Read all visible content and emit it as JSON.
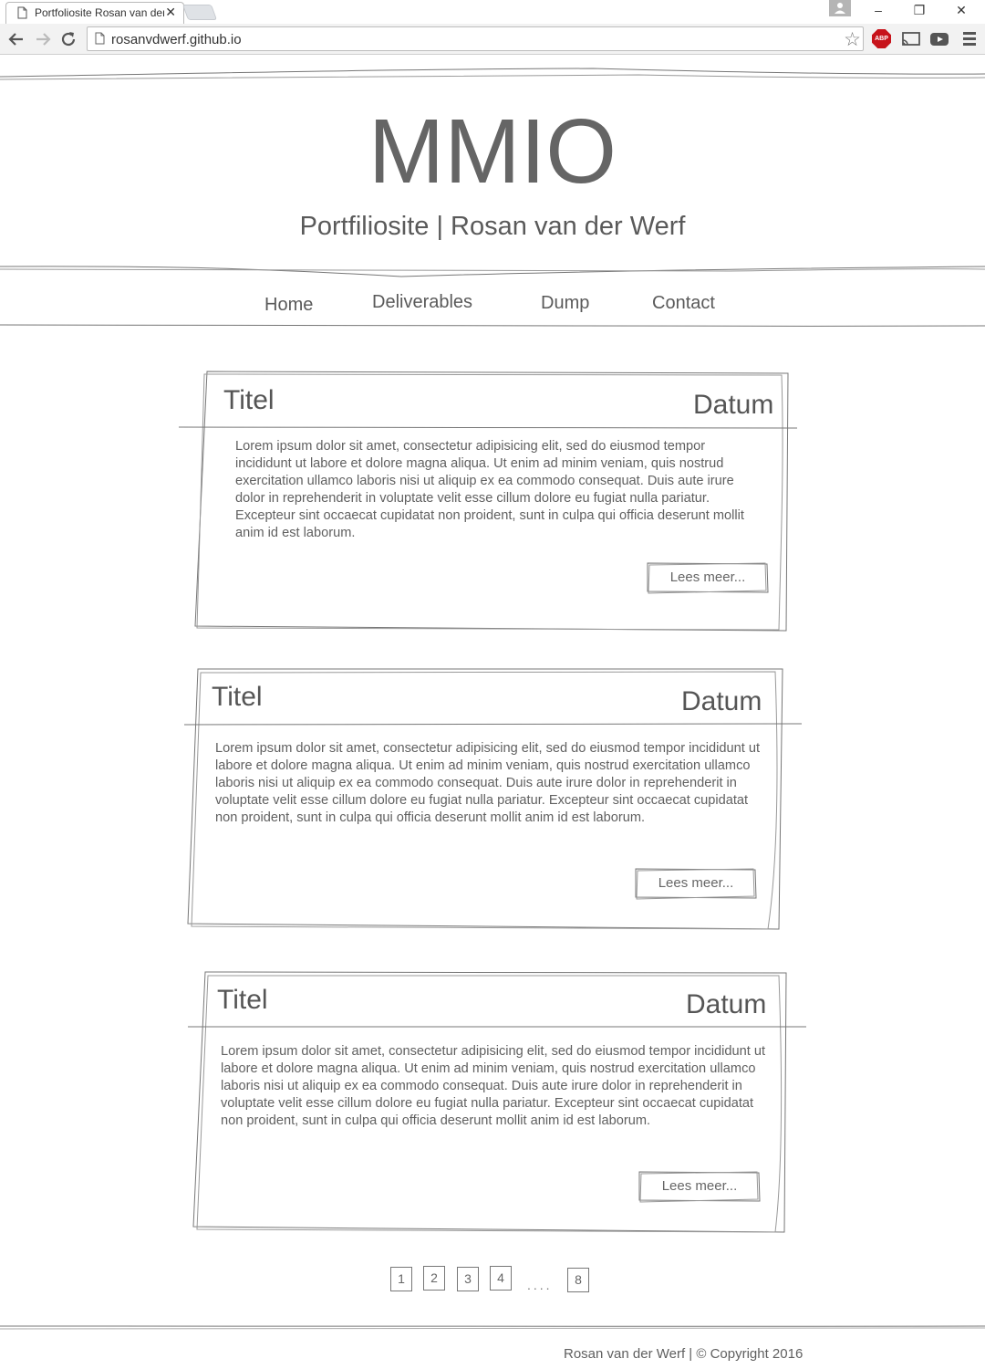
{
  "browser": {
    "tab_title": "Portfoliosite Rosan van der Werf",
    "url": "rosanvdwerf.github.io",
    "tab_close": "✕",
    "window_controls": {
      "minimize": "–",
      "restore": "❐",
      "close": "✕"
    },
    "extensions": [
      "abp-icon",
      "cast-icon",
      "youtube-icon"
    ],
    "abp_label": "ABP"
  },
  "header": {
    "title": "MMIO",
    "subtitle": "Portfiliosite | Rosan van der Werf"
  },
  "nav": {
    "items": [
      {
        "label": "Home"
      },
      {
        "label": "Deliverables"
      },
      {
        "label": "Dump"
      },
      {
        "label": "Contact"
      }
    ]
  },
  "posts": [
    {
      "title": "Titel",
      "date": "Datum",
      "body": "Lorem ipsum dolor sit amet, consectetur adipisicing elit, sed do eiusmod tempor incididunt ut labore et dolore magna aliqua. Ut enim ad minim veniam, quis nostrud exercitation ullamco laboris nisi ut aliquip ex ea commodo consequat. Duis aute irure dolor in reprehenderit in voluptate velit esse cillum dolore eu fugiat nulla pariatur. Excepteur sint occaecat cupidatat non proident, sunt in culpa qui officia deserunt mollit anim id est laborum.",
      "button": "Lees meer..."
    },
    {
      "title": "Titel",
      "date": "Datum",
      "body": "Lorem ipsum dolor sit amet, consectetur adipisicing elit, sed do eiusmod tempor incididunt ut labore et dolore magna aliqua. Ut enim ad minim veniam, quis nostrud exercitation ullamco laboris nisi ut aliquip ex ea commodo consequat. Duis aute irure dolor in reprehenderit in voluptate velit esse cillum dolore eu fugiat nulla pariatur. Excepteur sint occaecat cupidatat non proident, sunt in culpa qui officia deserunt mollit anim id est laborum.",
      "button": "Lees meer..."
    },
    {
      "title": "Titel",
      "date": "Datum",
      "body": "Lorem ipsum dolor sit amet, consectetur adipisicing elit, sed do eiusmod tempor incididunt ut labore et dolore magna aliqua. Ut enim ad minim veniam, quis nostrud exercitation ullamco laboris nisi ut aliquip ex ea commodo consequat. Duis aute irure dolor in reprehenderit in voluptate velit esse cillum dolore eu fugiat nulla pariatur. Excepteur sint occaecat cupidatat non proident, sunt in culpa qui officia deserunt mollit anim id est laborum.",
      "button": "Lees meer..."
    }
  ],
  "pagination": {
    "pages": [
      "1",
      "2",
      "3",
      "4"
    ],
    "ellipsis": "....",
    "last": "8"
  },
  "footer": {
    "text": "Rosan van der Werf | © Copyright 2016"
  }
}
